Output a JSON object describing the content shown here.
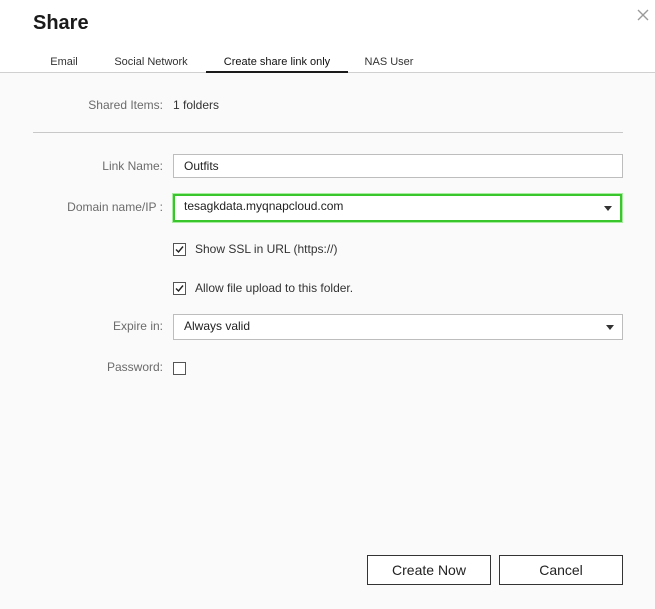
{
  "dialog": {
    "title": "Share"
  },
  "tabs": [
    {
      "label": "Email",
      "active": false
    },
    {
      "label": "Social Network",
      "active": false
    },
    {
      "label": "Create share link only",
      "active": true
    },
    {
      "label": "NAS User",
      "active": false
    }
  ],
  "form": {
    "shared_items": {
      "label": "Shared Items:",
      "value": "1 folders"
    },
    "link_name": {
      "label": "Link Name:",
      "value": "Outfits"
    },
    "domain": {
      "label": "Domain name/IP :",
      "value": "tesagkdata.myqnapcloud.com"
    },
    "show_ssl": {
      "label": "Show SSL in URL (https://)",
      "checked": true
    },
    "allow_upload": {
      "label": "Allow file upload to this folder.",
      "checked": true
    },
    "expire": {
      "label": "Expire in:",
      "value": "Always valid"
    },
    "password": {
      "label": "Password:",
      "checked": false
    }
  },
  "buttons": {
    "create": "Create Now",
    "cancel": "Cancel"
  },
  "colors": {
    "focus_border": "#39c62c",
    "background": "#fafafa"
  },
  "icons": {
    "close": "close-icon",
    "dropdown": "chevron-down-icon",
    "check": "checkmark-icon"
  }
}
